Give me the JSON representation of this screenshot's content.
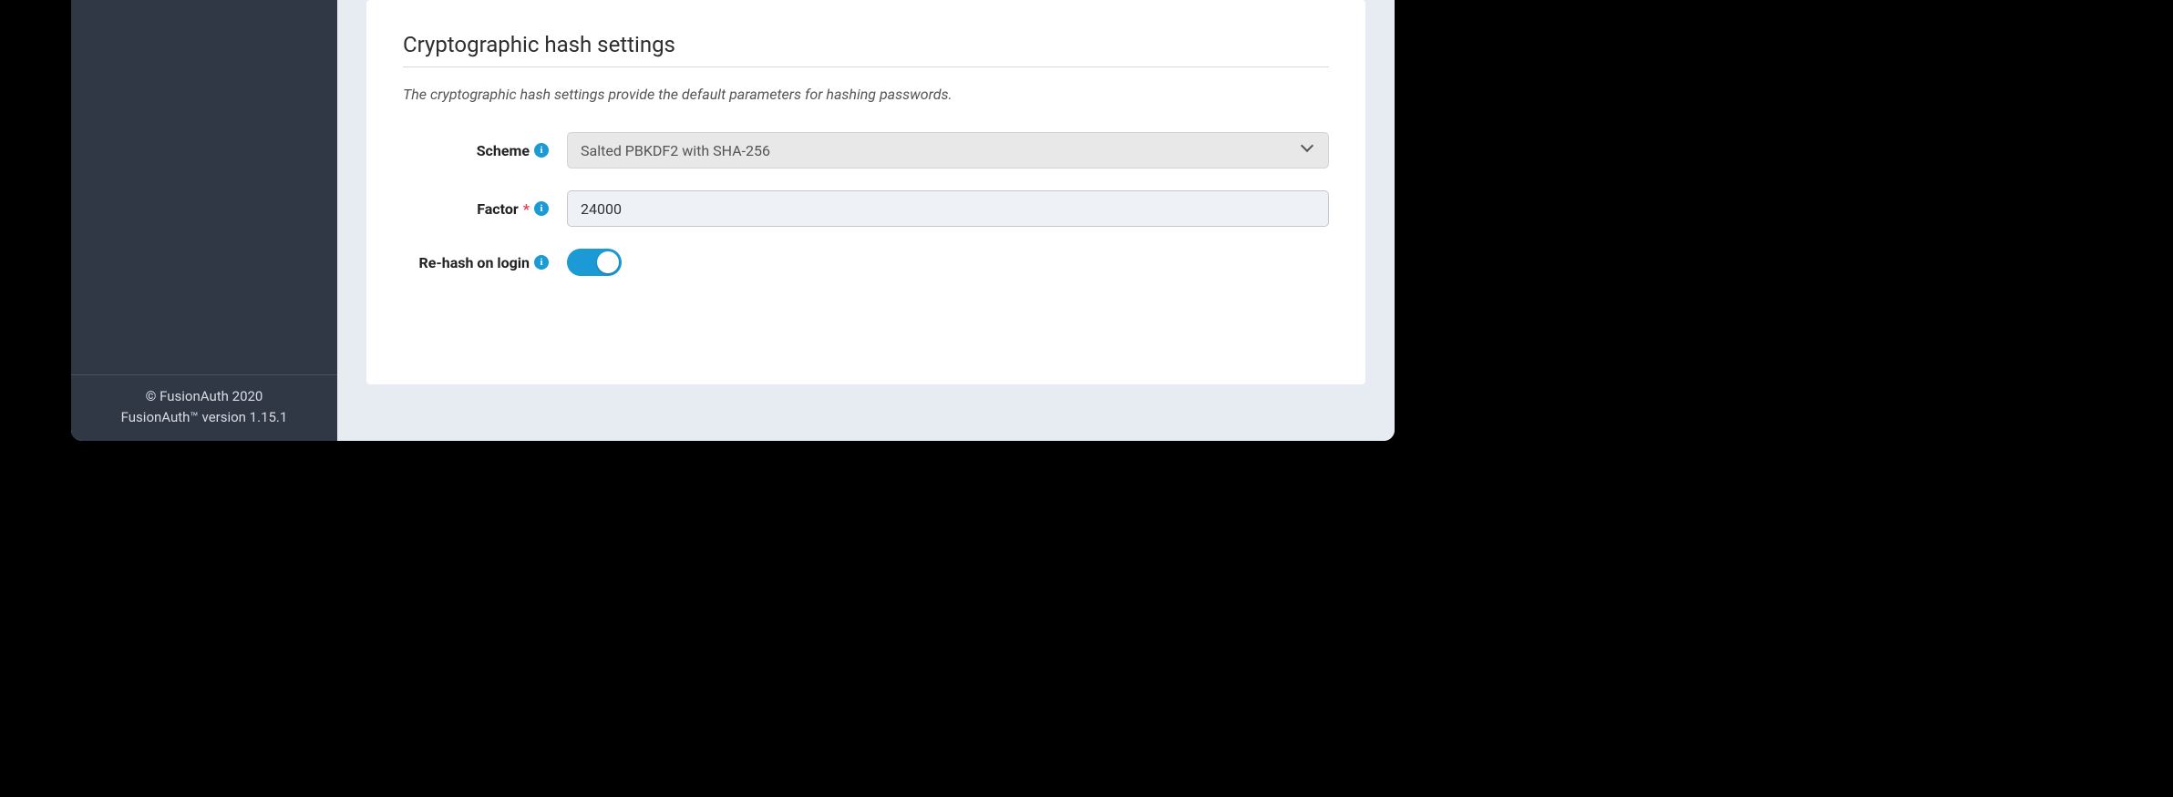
{
  "sidebar": {
    "footer": {
      "copyright": "© FusionAuth 2020",
      "version": "FusionAuth™ version 1.15.1"
    }
  },
  "main": {
    "section": {
      "title": "Cryptographic hash settings",
      "description": "The cryptographic hash settings provide the default parameters for hashing passwords.",
      "fields": {
        "scheme": {
          "label": "Scheme",
          "value": "Salted PBKDF2 with SHA-256",
          "required": false
        },
        "factor": {
          "label": "Factor",
          "value": "24000",
          "required": true,
          "asterisk": "*"
        },
        "rehash": {
          "label": "Re-hash on login",
          "value": true
        }
      }
    }
  },
  "icons": {
    "info": "i"
  }
}
